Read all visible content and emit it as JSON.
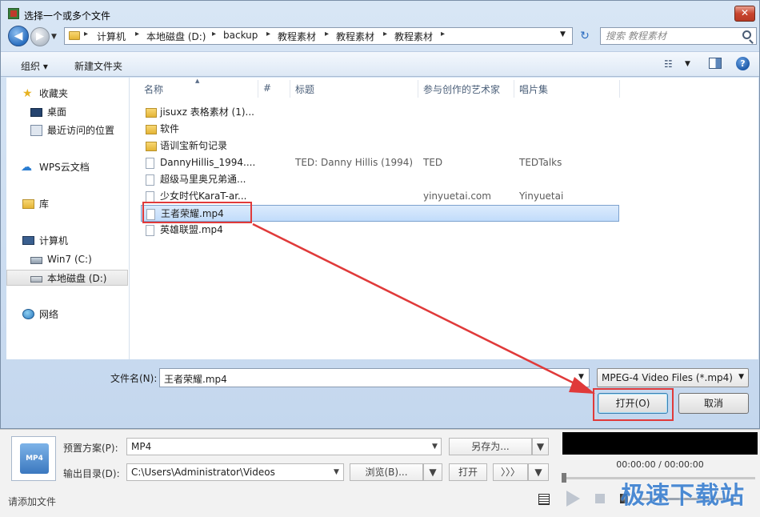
{
  "window": {
    "title": "选择一个或多个文件",
    "close_label": "✕"
  },
  "navigation": {
    "back_icon": "back-arrow-icon",
    "forward_icon": "forward-arrow-icon",
    "breadcrumb": [
      "计算机",
      "本地磁盘 (D:)",
      "backup",
      "教程素材",
      "教程素材",
      "教程素材"
    ],
    "search_placeholder": "搜索 教程素材"
  },
  "toolbar": {
    "organize_label": "组织 ▾",
    "new_folder_label": "新建文件夹"
  },
  "sidebar": {
    "items": [
      {
        "label": "收藏夹",
        "icon": "star-icon"
      },
      {
        "label": "桌面",
        "icon": "desktop-icon"
      },
      {
        "label": "最近访问的位置",
        "icon": "recent-places-icon"
      },
      {
        "label": "WPS云文档",
        "icon": "cloud-icon"
      },
      {
        "label": "库",
        "icon": "library-icon"
      },
      {
        "label": "计算机",
        "icon": "computer-icon"
      },
      {
        "label": "Win7 (C:)",
        "icon": "system-drive-icon"
      },
      {
        "label": "本地磁盘 (D:)",
        "icon": "drive-icon",
        "selected": true
      },
      {
        "label": "网络",
        "icon": "network-icon"
      }
    ]
  },
  "file_list": {
    "columns": [
      "名称",
      "#",
      "标题",
      "参与创作的艺术家",
      "唱片集"
    ],
    "rows": [
      {
        "type": "folder",
        "name": "jisuxz 表格素材 (1)...",
        "num": "",
        "title": "",
        "artist": "",
        "album": ""
      },
      {
        "type": "folder",
        "name": "软件",
        "num": "",
        "title": "",
        "artist": "",
        "album": ""
      },
      {
        "type": "folder",
        "name": "语训宝新句记录",
        "num": "",
        "title": "",
        "artist": "",
        "album": ""
      },
      {
        "type": "file",
        "name": "DannyHillis_1994....",
        "num": "",
        "title": "TED: Danny Hillis (1994)",
        "artist": "TED",
        "album": "TEDTalks"
      },
      {
        "type": "file",
        "name": "超级马里奥兄弟通...",
        "num": "",
        "title": "",
        "artist": "",
        "album": ""
      },
      {
        "type": "file",
        "name": "少女时代KaraT-ar...",
        "num": "",
        "title": "",
        "artist": "yinyuetai.com",
        "album": "Yinyuetai"
      },
      {
        "type": "file",
        "name": "王者荣耀.mp4",
        "num": "",
        "title": "",
        "artist": "",
        "album": "",
        "selected": true
      },
      {
        "type": "file",
        "name": "英雄联盟.mp4",
        "num": "",
        "title": "",
        "artist": "",
        "album": ""
      }
    ]
  },
  "footer": {
    "filename_label": "文件名(N):",
    "filename_value": "王者荣耀.mp4",
    "filter_value": "MPEG-4 Video Files (*.mp4)",
    "open_label": "打开(O)",
    "cancel_label": "取消"
  },
  "app": {
    "format_badge": "MP4",
    "preset_label": "预置方案(P):",
    "preset_value": "MP4",
    "save_as_label": "另存为...",
    "output_label": "输出目录(D):",
    "output_value": "C:\\Users\\Administrator\\Videos",
    "browse_label": "浏览(B)...",
    "open_label": "打开",
    "more_label": "〉〉〉",
    "time_readout": "00:00:00 / 00:00:00",
    "status_text": "请添加文件",
    "watermark": "极速下载站"
  },
  "colors": {
    "annotation": "#e03a3a",
    "selection": "#c1dcfb",
    "watermark": "#3a7fd0"
  }
}
